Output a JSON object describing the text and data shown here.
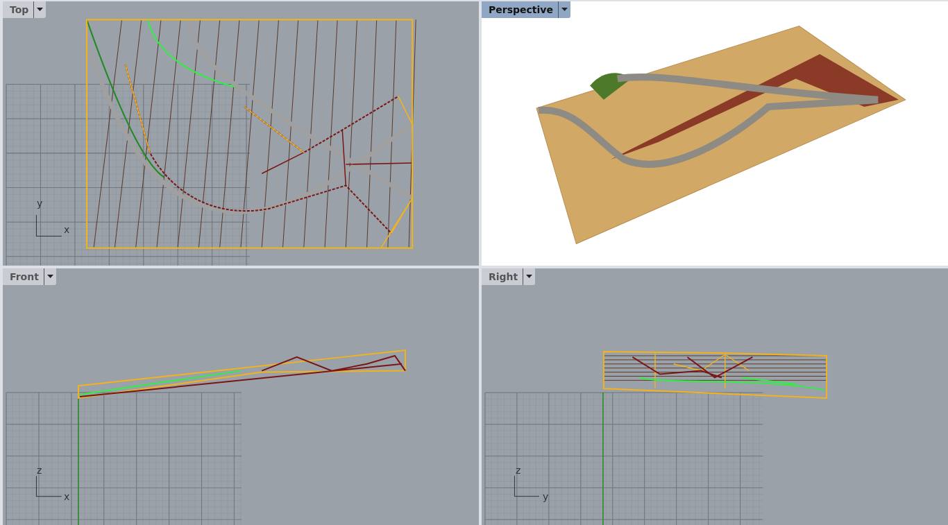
{
  "viewports": [
    {
      "label": "Top",
      "selected": false,
      "kind": "top",
      "axes": [
        "y",
        "x"
      ]
    },
    {
      "label": "Perspective",
      "selected": true,
      "kind": "perspective"
    },
    {
      "label": "Front",
      "selected": false,
      "kind": "front",
      "axes": [
        "z",
        "x"
      ]
    },
    {
      "label": "Right",
      "selected": false,
      "kind": "right",
      "axes": [
        "z",
        "y"
      ]
    }
  ]
}
